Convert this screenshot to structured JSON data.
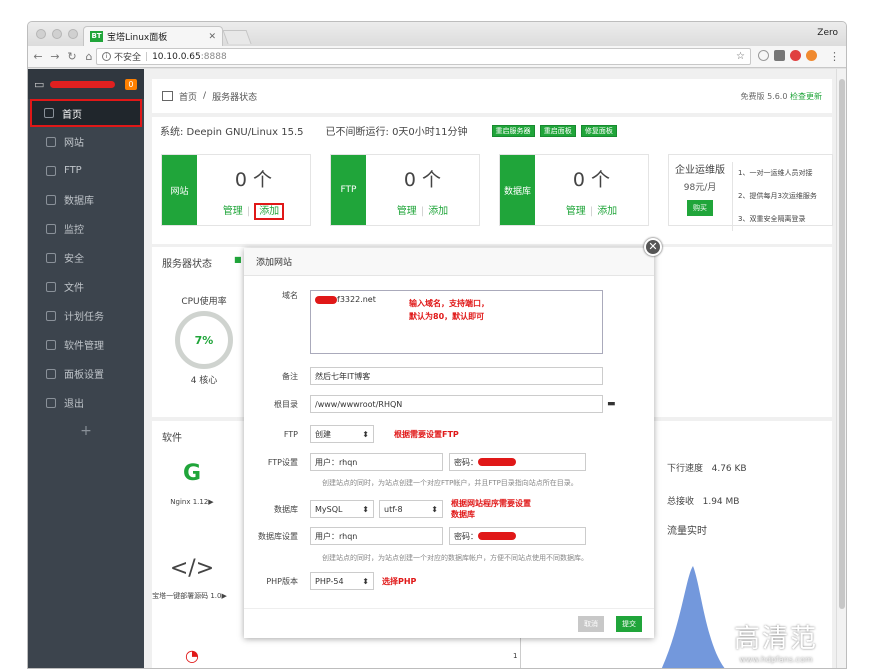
{
  "browser": {
    "tab_title": "宝塔Linux面板",
    "tab_favicon": "BT",
    "profile": "Zero",
    "security": "不安全",
    "url_host": "10.10.0.65",
    "url_port": ":8888"
  },
  "sidebar": {
    "badge": "0",
    "items": [
      {
        "label": "首页",
        "icon": "home-icon"
      },
      {
        "label": "网站",
        "icon": "globe-icon"
      },
      {
        "label": "FTP",
        "icon": "ftp-icon"
      },
      {
        "label": "数据库",
        "icon": "database-icon"
      },
      {
        "label": "监控",
        "icon": "monitor-icon"
      },
      {
        "label": "安全",
        "icon": "shield-icon"
      },
      {
        "label": "文件",
        "icon": "folder-icon"
      },
      {
        "label": "计划任务",
        "icon": "calendar-icon"
      },
      {
        "label": "软件管理",
        "icon": "grid-icon"
      },
      {
        "label": "面板设置",
        "icon": "gear-icon"
      },
      {
        "label": "退出",
        "icon": "logout-icon"
      }
    ],
    "add": "+"
  },
  "breadcrumb": {
    "home": "首页",
    "sep": "/",
    "current": "服务器状态",
    "version": "免费版 5.6.0",
    "update": "检查更新"
  },
  "system": {
    "os": "系统: Deepin GNU/Linux 15.5",
    "uptime": "已不间断运行: 0天0小时11分钟",
    "btn_restart_server": "重启服务器",
    "btn_restart_panel": "重启面板",
    "btn_repair": "修复面板"
  },
  "stats": [
    {
      "label": "网站",
      "count": "0 个",
      "manage": "管理",
      "add": "添加"
    },
    {
      "label": "FTP",
      "count": "0 个",
      "manage": "管理",
      "add": "添加"
    },
    {
      "label": "数据库",
      "count": "0 个",
      "manage": "管理",
      "add": "添加"
    }
  ],
  "enterprise": {
    "title": "企业运维版",
    "price": "98元/月",
    "buy": "购买",
    "items": [
      "1、一对一运维人员对接",
      "2、提供每月3次运维服务",
      "3、双重安全隔离登录"
    ]
  },
  "server_status": {
    "title": "服务器状态",
    "cpu_label": "CPU使用率",
    "cpu_value": "7%",
    "cores": "4 核心"
  },
  "software": {
    "title": "软件",
    "items": [
      {
        "glyph": "G",
        "name": "Nginx 1.12▶"
      },
      {
        "glyph": "</>",
        "name": "宝塔一键部署源码 1.0▶"
      }
    ],
    "down_speed_label": "下行速度",
    "down_speed": "4.76 KB",
    "total_recv_label": "总接收",
    "total_recv": "1.94 MB",
    "traffic": "流量实时",
    "axis_tick": "1"
  },
  "dialog": {
    "title": "添加网站",
    "domain_label": "域名",
    "domain_value": "f3322.net",
    "domain_annotation_1": "输入域名，支持端口，",
    "domain_annotation_2": "默认为80，默认即可",
    "note_label": "备注",
    "note_value": "然后七年IT博客",
    "root_label": "根目录",
    "root_value": "/www/wwwroot/RHQN",
    "ftp_label": "FTP",
    "ftp_option": "创建",
    "ftp_annotation": "根据需要设置FTP",
    "ftp_setting_label": "FTP设置",
    "user_label": "用户：",
    "ftp_user": "rhqn",
    "pass_label": "密码：",
    "ftp_hint": "创建站点的同时，为站点创建一个对应FTP帐户，并且FTP目录指向站点所在目录。",
    "db_label": "数据库",
    "db_type": "MySQL",
    "db_charset": "utf-8",
    "db_annotation_1": "根据网站程序需要设置",
    "db_annotation_2": "数据库",
    "db_setting_label": "数据库设置",
    "db_user": "rhqn",
    "db_hint": "创建站点的同时，为站点创建一个对应的数据库帐户，方便不同站点使用不同数据库。",
    "php_label": "PHP版本",
    "php_value": "PHP-54",
    "php_annotation": "选择PHP",
    "cancel": "取消",
    "submit": "提交"
  },
  "watermark": {
    "big": "高清范",
    "small": "www.hdpfans.com"
  }
}
